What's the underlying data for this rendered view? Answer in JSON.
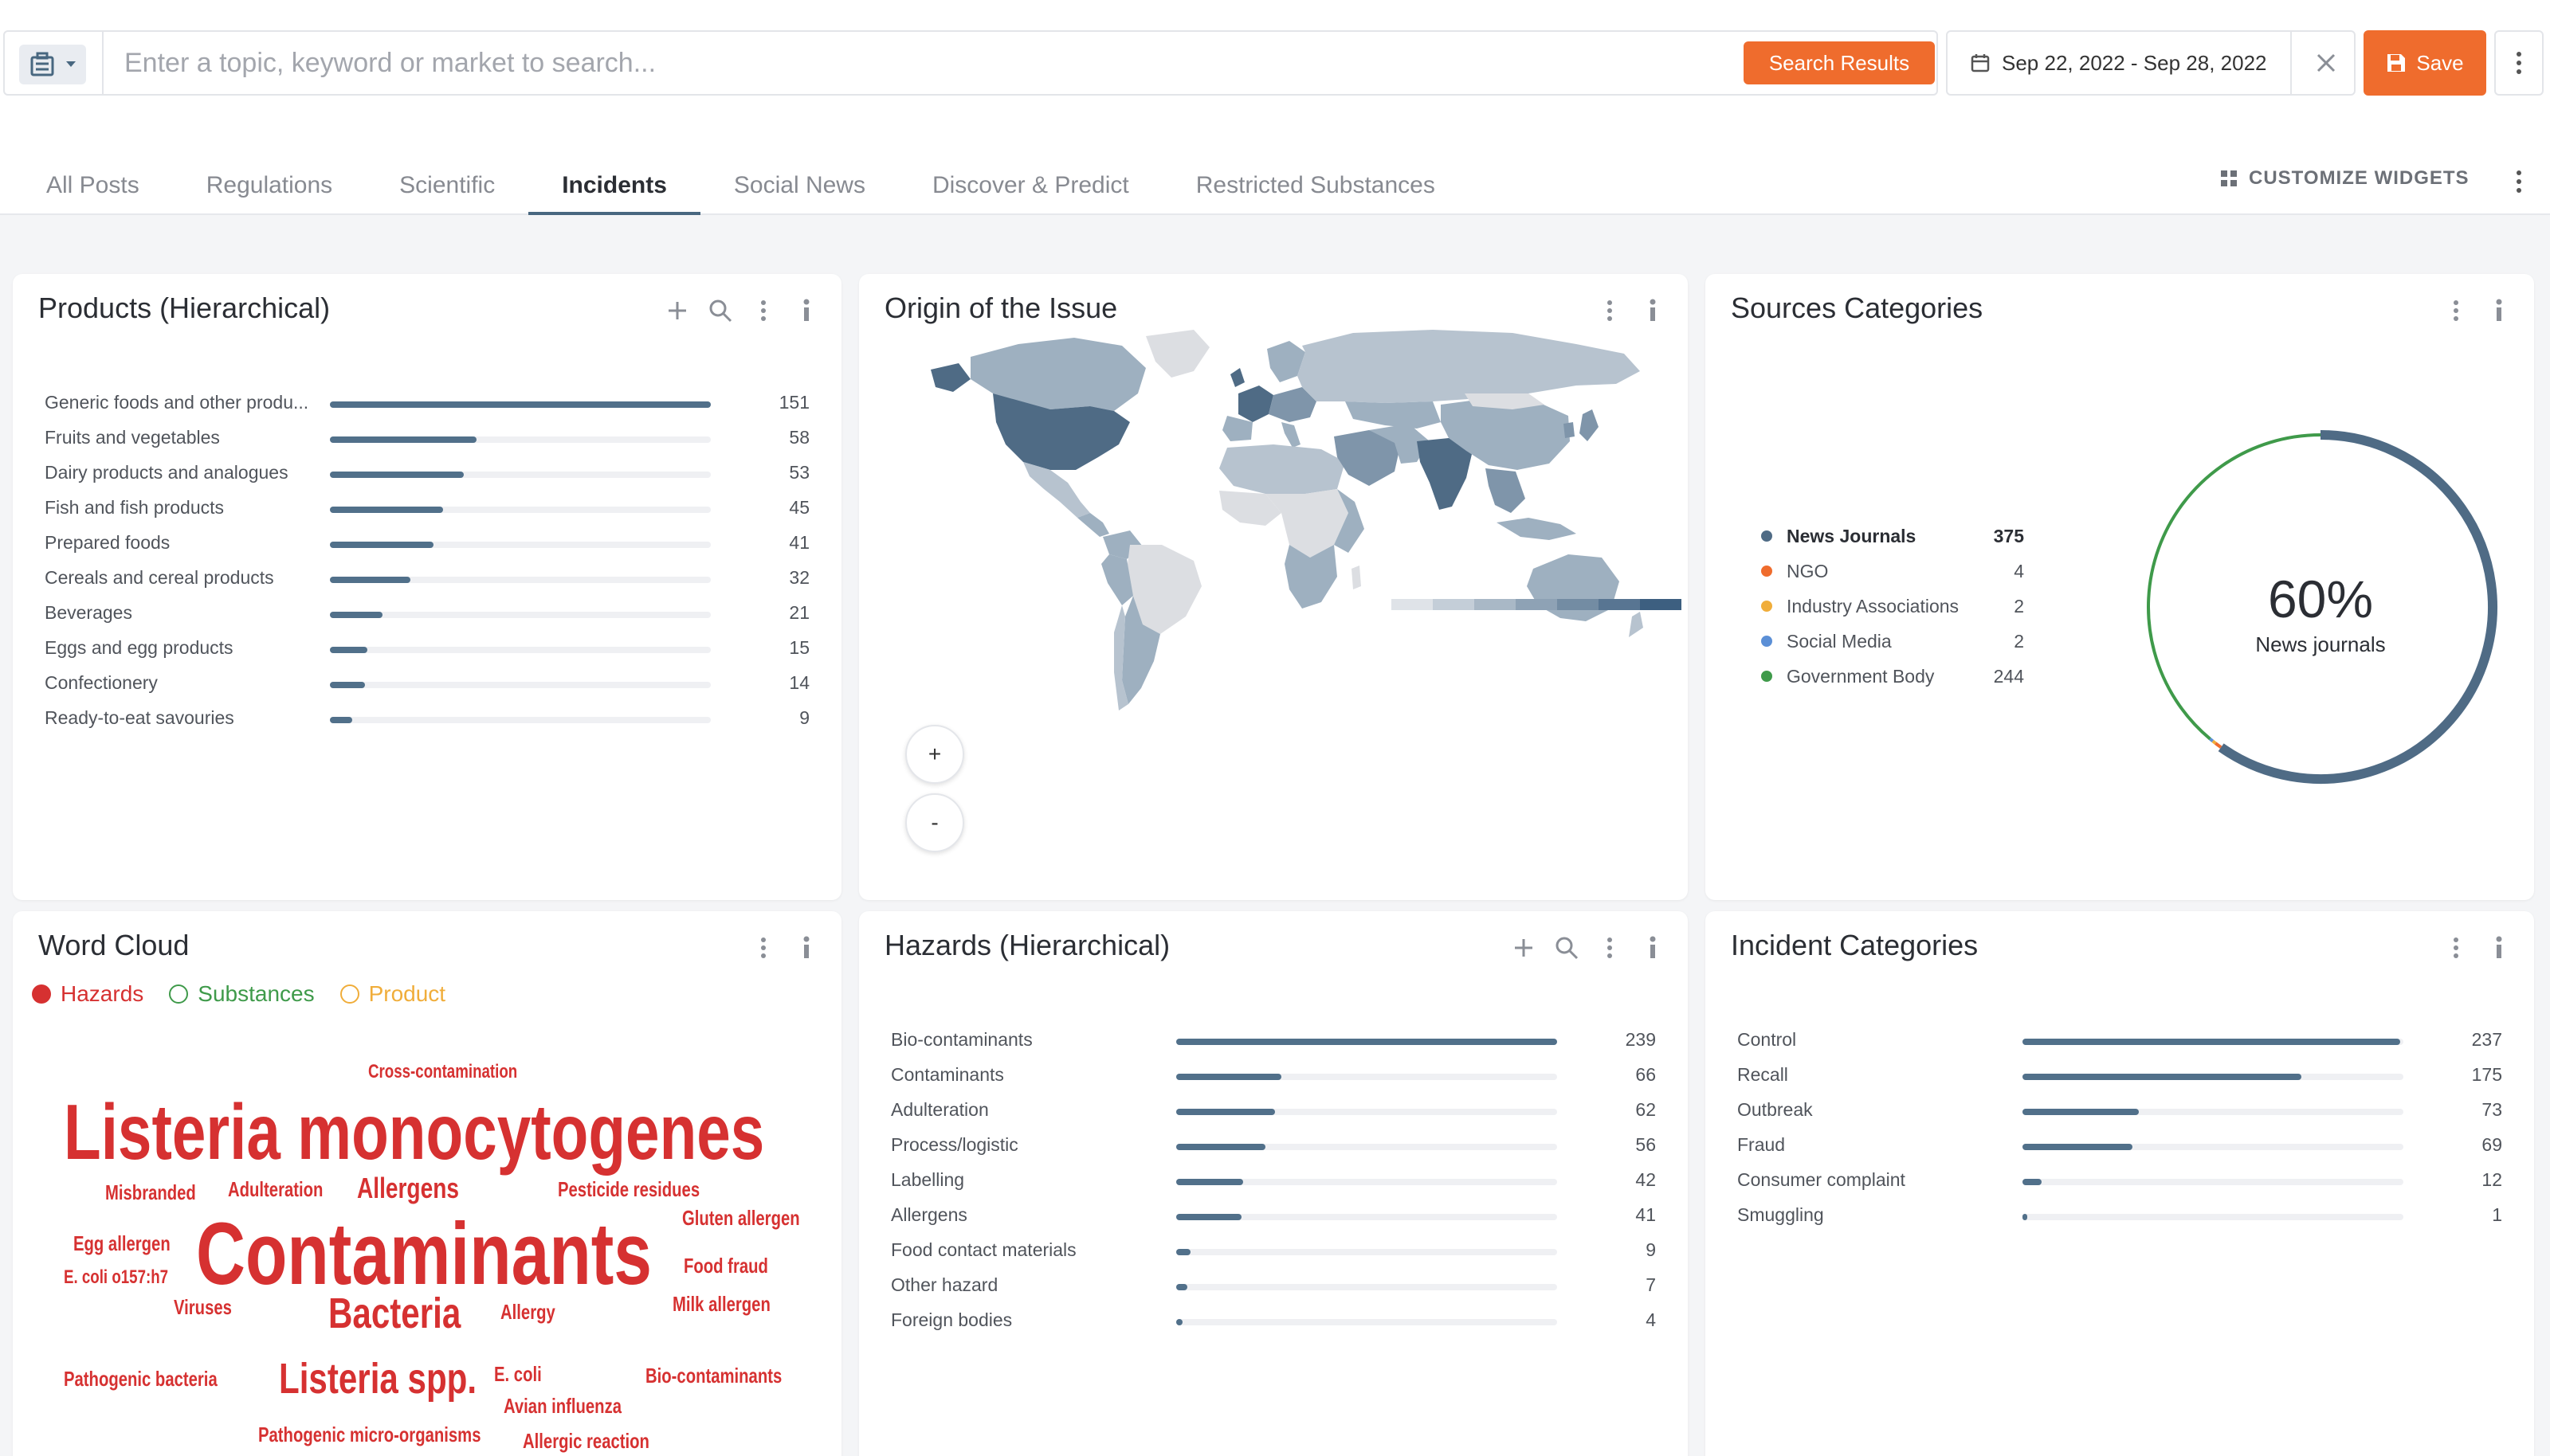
{
  "search": {
    "placeholder": "Enter a topic, keyword or market to search...",
    "value": "",
    "results_button": "Search Results"
  },
  "date_range": "Sep 22, 2022 - Sep 28, 2022",
  "save_label": "Save",
  "tabs": [
    "All Posts",
    "Regulations",
    "Scientific",
    "Incidents",
    "Social News",
    "Discover & Predict",
    "Restricted Substances"
  ],
  "active_tab": "Incidents",
  "customize_label": "CUSTOMIZE WIDGETS",
  "colors": {
    "accent": "#ef6c2d",
    "bar": "#51708a",
    "track": "#eff0f3",
    "word": "#d63131"
  },
  "products": {
    "title": "Products (Hierarchical)",
    "items": [
      {
        "label": "Generic foods and other produ...",
        "value": 151
      },
      {
        "label": "Fruits and vegetables",
        "value": 58
      },
      {
        "label": "Dairy products and analogues",
        "value": 53
      },
      {
        "label": "Fish and fish products",
        "value": 45
      },
      {
        "label": "Prepared foods",
        "value": 41
      },
      {
        "label": "Cereals and cereal products",
        "value": 32
      },
      {
        "label": "Beverages",
        "value": 21
      },
      {
        "label": "Eggs and egg products",
        "value": 15
      },
      {
        "label": "Confectionery",
        "value": 14
      },
      {
        "label": "Ready-to-eat savouries",
        "value": 9
      }
    ]
  },
  "origin": {
    "title": "Origin of the Issue",
    "zoom_in": "+",
    "zoom_out": "-"
  },
  "sources": {
    "title": "Sources Categories",
    "items": [
      {
        "label": "News Journals",
        "value": 375,
        "color": "#4f6b85"
      },
      {
        "label": "NGO",
        "value": 4,
        "color": "#ef6c2d"
      },
      {
        "label": "Industry Associations",
        "value": 2,
        "color": "#f0ad3a"
      },
      {
        "label": "Social Media",
        "value": 2,
        "color": "#5b8fd6"
      },
      {
        "label": "Government Body",
        "value": 244,
        "color": "#3f9a4a"
      }
    ],
    "center_pct": "60%",
    "center_label": "News journals"
  },
  "wordcloud": {
    "title": "Word Cloud",
    "legend": [
      {
        "label": "Hazards",
        "color": "#d63131",
        "filled": true
      },
      {
        "label": "Substances",
        "color": "#3f9a4a",
        "filled": false
      },
      {
        "label": "Product",
        "color": "#f0ad3a",
        "filled": false
      }
    ],
    "words": [
      "Cross-contamination",
      "Listeria monocytogenes",
      "Misbranded",
      "Adulteration",
      "Allergens",
      "Pesticide residues",
      "Gluten allergen",
      "Egg allergen",
      "Contaminants",
      "Food fraud",
      "E. coli o157:h7",
      "Viruses",
      "Bacteria",
      "Allergy",
      "Milk allergen",
      "Pathogenic bacteria",
      "Listeria spp.",
      "E. coli",
      "Bio-contaminants",
      "Avian influenza",
      "Pathogenic micro-organisms",
      "Allergic reaction"
    ]
  },
  "hazards": {
    "title": "Hazards (Hierarchical)",
    "items": [
      {
        "label": "Bio-contaminants",
        "value": 239
      },
      {
        "label": "Contaminants",
        "value": 66
      },
      {
        "label": "Adulteration",
        "value": 62
      },
      {
        "label": "Process/logistic",
        "value": 56
      },
      {
        "label": "Labelling",
        "value": 42
      },
      {
        "label": "Allergens",
        "value": 41
      },
      {
        "label": "Food contact materials",
        "value": 9
      },
      {
        "label": "Other hazard",
        "value": 7
      },
      {
        "label": "Foreign bodies",
        "value": 4
      }
    ]
  },
  "incidents": {
    "title": "Incident Categories",
    "items": [
      {
        "label": "Control",
        "value": 237
      },
      {
        "label": "Recall",
        "value": 175
      },
      {
        "label": "Outbreak",
        "value": 73
      },
      {
        "label": "Fraud",
        "value": 69
      },
      {
        "label": "Consumer complaint",
        "value": 12
      },
      {
        "label": "Smuggling",
        "value": 1
      }
    ]
  }
}
